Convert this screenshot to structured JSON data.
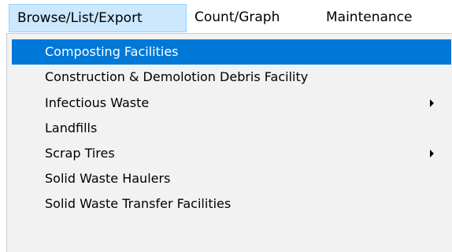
{
  "menubar": {
    "items": [
      {
        "label": "Browse/List/Export"
      },
      {
        "label": "Count/Graph"
      },
      {
        "label": "Maintenance"
      }
    ]
  },
  "dropdown": {
    "items": [
      {
        "label": "Composting Facilities",
        "selected": true,
        "has_submenu": false
      },
      {
        "label": "Construction & Demolotion Debris Facility",
        "selected": false,
        "has_submenu": false
      },
      {
        "label": "Infectious Waste",
        "selected": false,
        "has_submenu": true,
        "submenu_icon": "chevron-right-icon"
      },
      {
        "label": "Landfills",
        "selected": false,
        "has_submenu": false
      },
      {
        "label": "Scrap Tires",
        "selected": false,
        "has_submenu": true,
        "submenu_icon": "chevron-right-icon"
      },
      {
        "label": "Solid Waste Haulers",
        "selected": false,
        "has_submenu": false
      },
      {
        "label": "Solid Waste Transfer Facilities",
        "selected": false,
        "has_submenu": false
      }
    ]
  },
  "colors": {
    "highlight": "#0078d7",
    "open_menu_background": "#cce8ff",
    "open_menu_border": "#99d1ff",
    "menu_background": "#f2f2f2"
  }
}
